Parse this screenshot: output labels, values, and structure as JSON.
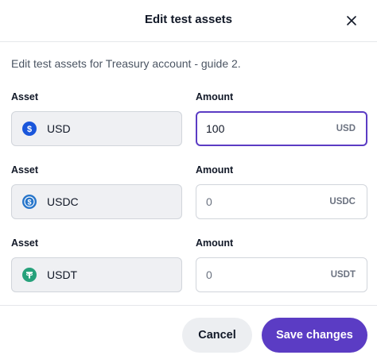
{
  "modal": {
    "title": "Edit test assets",
    "description": "Edit test assets for Treasury account - guide 2."
  },
  "rows": [
    {
      "asset_label": "Asset",
      "amount_label": "Amount",
      "asset": "USD",
      "icon": "usd-coin-icon",
      "icon_color": "#1a56db",
      "amount_value": "100",
      "amount_placeholder": "",
      "unit": "USD",
      "focused": true
    },
    {
      "asset_label": "Asset",
      "amount_label": "Amount",
      "asset": "USDC",
      "icon": "usdc-coin-icon",
      "icon_color": "#2775ca",
      "amount_value": "",
      "amount_placeholder": "0",
      "unit": "USDC",
      "focused": false
    },
    {
      "asset_label": "Asset",
      "amount_label": "Amount",
      "asset": "USDT",
      "icon": "usdt-coin-icon",
      "icon_color": "#26a17b",
      "amount_value": "",
      "amount_placeholder": "0",
      "unit": "USDT",
      "focused": false
    }
  ],
  "footer": {
    "cancel_label": "Cancel",
    "save_label": "Save changes"
  },
  "colors": {
    "accent": "#5b3cc4",
    "asset_field_bg": "#eff0f3",
    "border": "#d1d5db"
  }
}
